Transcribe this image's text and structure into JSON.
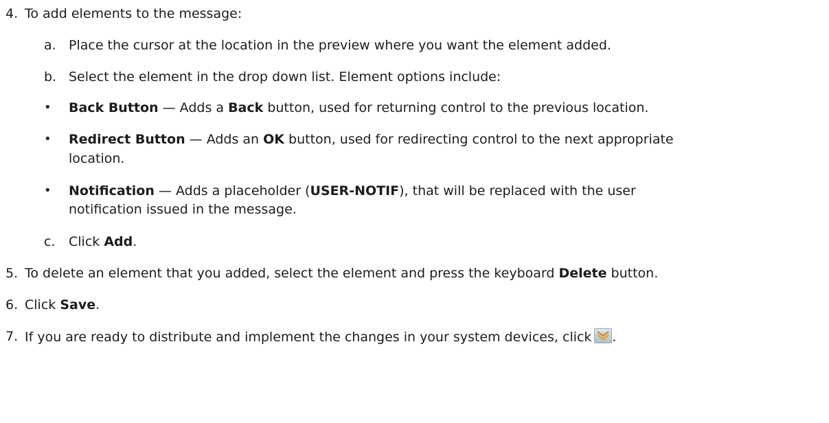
{
  "step4": {
    "num": "4.",
    "text": "To add elements to the message:",
    "a": {
      "letter": "a.",
      "text": "Place the cursor at the location in the preview where you want the element added."
    },
    "b": {
      "letter": "b.",
      "text": "Select the element in the drop down list. Element options include:"
    },
    "bullets": [
      {
        "term": "Back Button",
        "pre": " — Adds a ",
        "bold": "Back",
        "post": " button, used for returning control to the previous location."
      },
      {
        "term": "Redirect Button",
        "pre": " — Adds an ",
        "bold": "OK",
        "post": " button, used for redirecting control to the next appropriate",
        "cont": "location."
      },
      {
        "term": "Notification",
        "pre": " — Adds a placeholder (",
        "bold": "USER-NOTIF",
        "post": "), that will be replaced with the user",
        "cont": "notification issued in the message."
      }
    ],
    "c": {
      "letter": "c.",
      "pre": "Click ",
      "bold": "Add",
      "post": "."
    }
  },
  "step5": {
    "num": "5.",
    "pre": "To delete an element that you added, select the element and press the keyboard ",
    "bold": "Delete",
    "post": " button."
  },
  "step6": {
    "num": "6.",
    "pre": "Click ",
    "bold": "Save",
    "post": "."
  },
  "step7": {
    "num": "7.",
    "text": "If you are ready to distribute and implement the changes in your system devices, click",
    "post": ".",
    "icon": "distribute-icon"
  },
  "bullet_char": "•"
}
